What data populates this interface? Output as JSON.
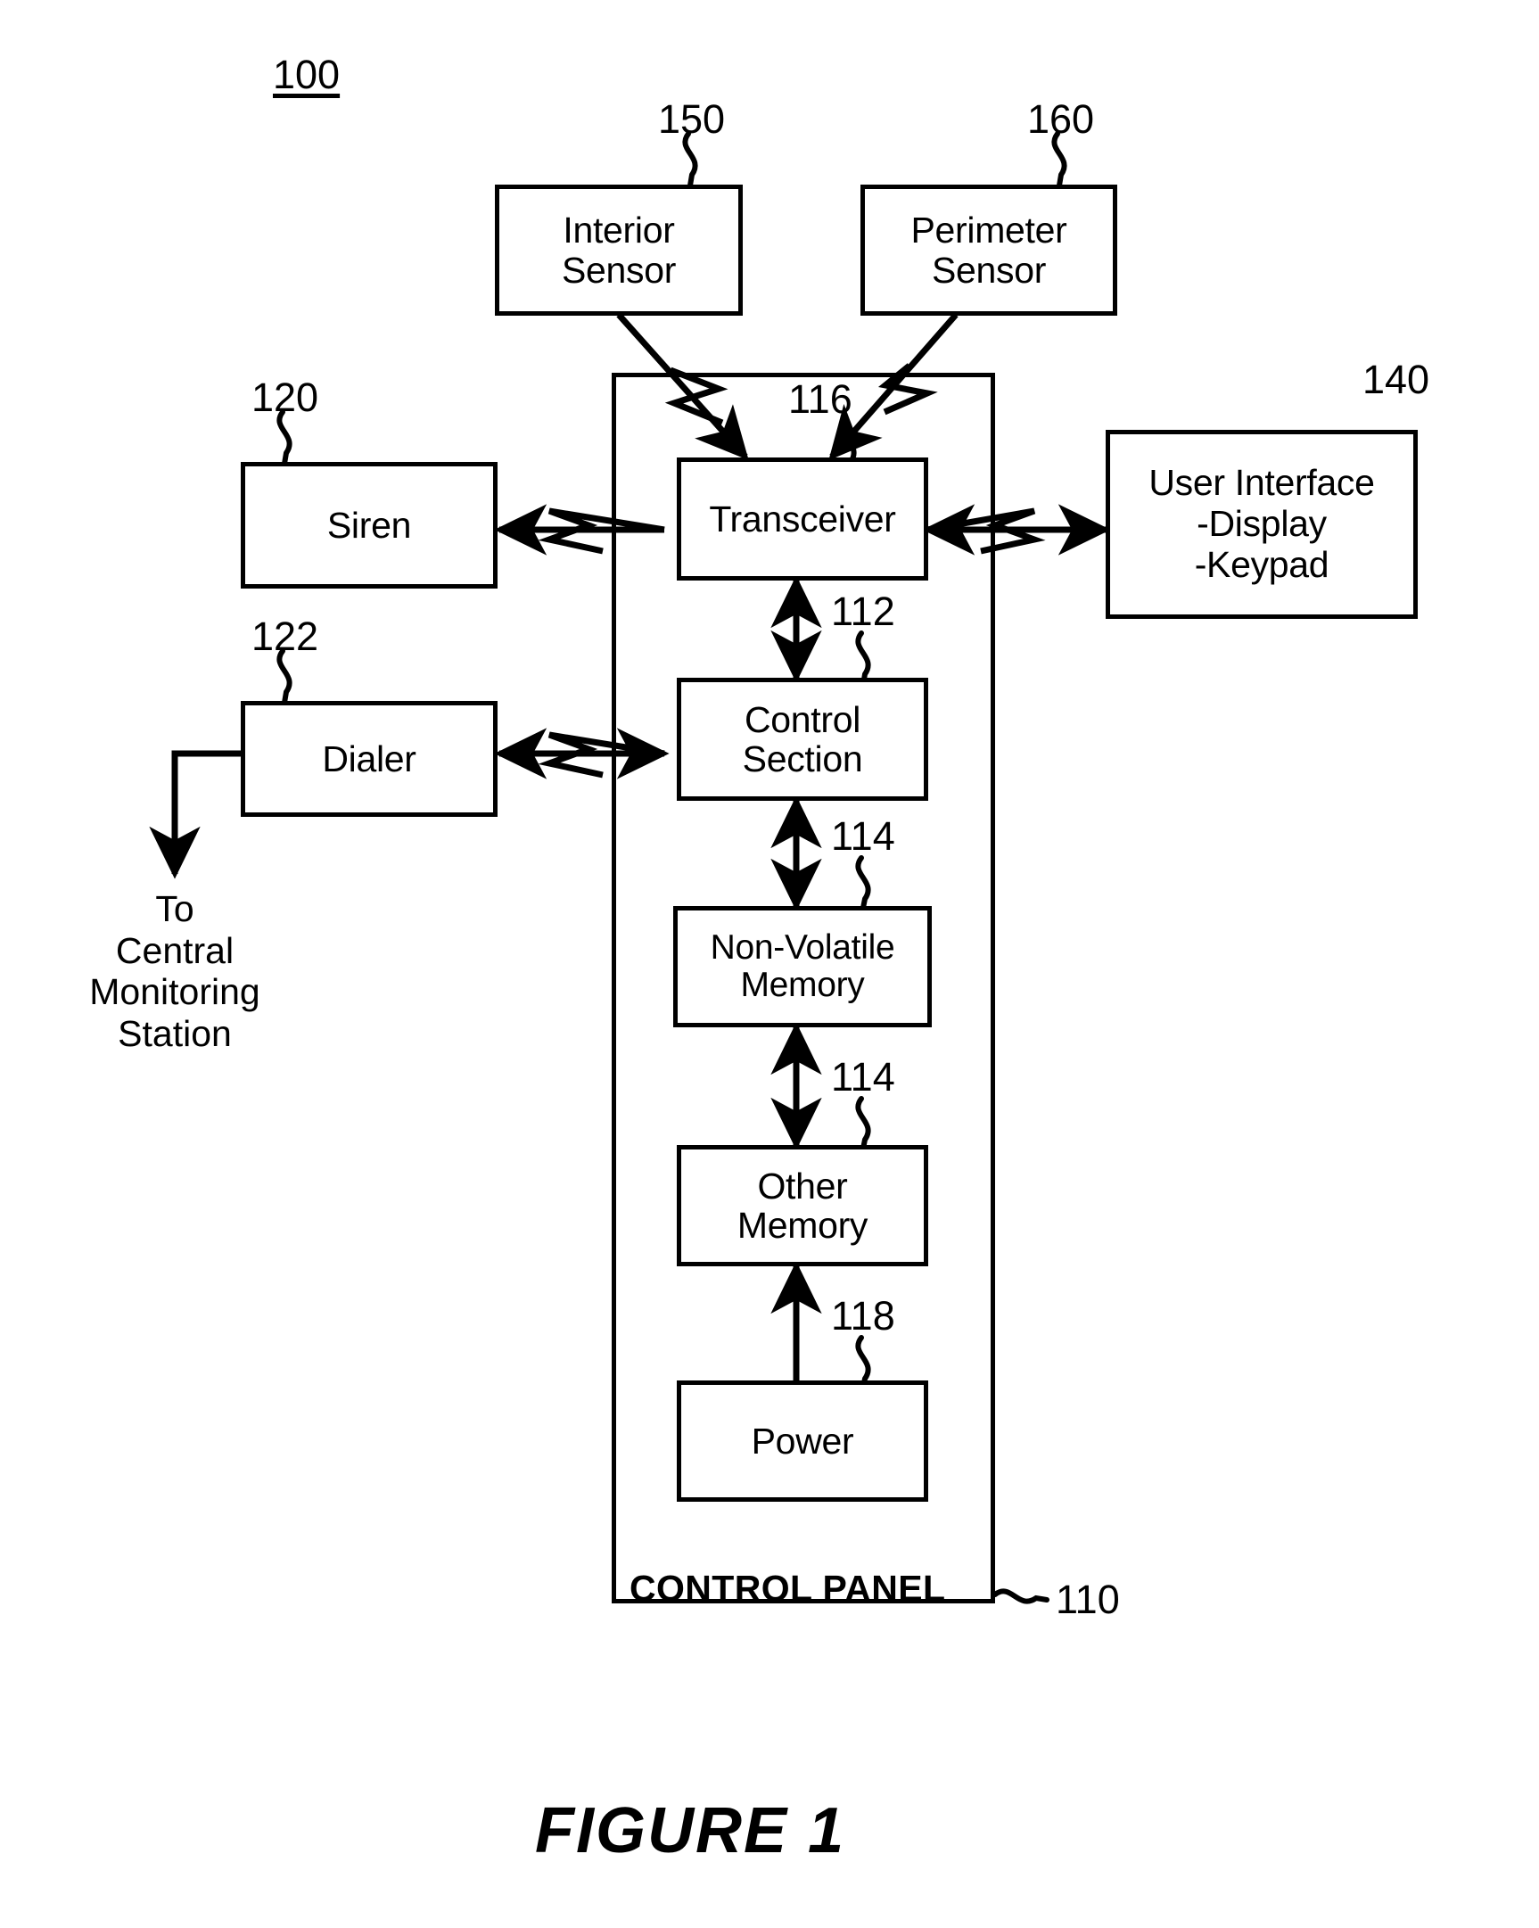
{
  "figure": {
    "caption": "FIGURE 1",
    "system_ref": "100"
  },
  "panel": {
    "caption": "CONTROL PANEL",
    "ref": "110"
  },
  "nodes": {
    "interior_sensor": {
      "label": "Interior\nSensor",
      "ref": "150"
    },
    "perimeter_sensor": {
      "label": "Perimeter\nSensor",
      "ref": "160"
    },
    "transceiver": {
      "label": "Transceiver",
      "ref": "116"
    },
    "siren": {
      "label": "Siren",
      "ref": "120"
    },
    "dialer": {
      "label": "Dialer",
      "ref": "122"
    },
    "user_interface": {
      "label": "User Interface\n-Display\n-Keypad",
      "ref": "140"
    },
    "control_section": {
      "label": "Control\nSection",
      "ref": "112"
    },
    "non_volatile_memory": {
      "label": "Non-Volatile\nMemory",
      "ref": "114"
    },
    "other_memory": {
      "label": "Other\nMemory",
      "ref": "114"
    },
    "power": {
      "label": "Power",
      "ref": "118"
    }
  },
  "annotations": {
    "central_station": "To\nCentral\nMonitoring\nStation"
  },
  "colors": {
    "stroke": "#000000",
    "background": "#ffffff"
  }
}
